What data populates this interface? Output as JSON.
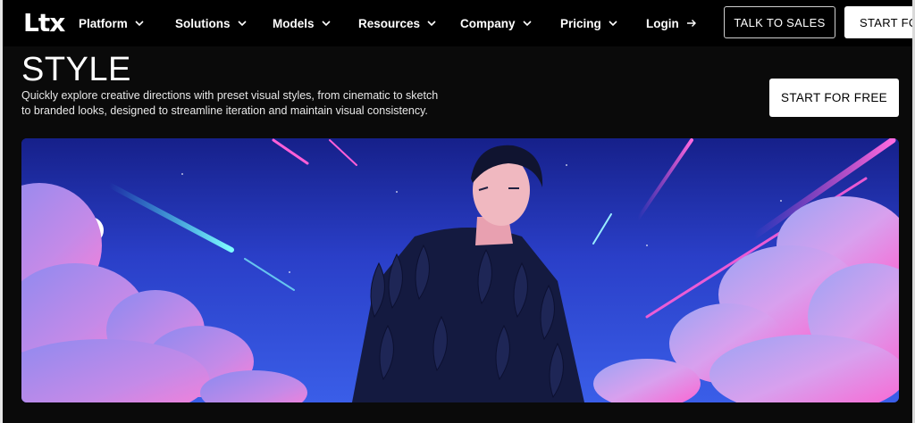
{
  "nav": {
    "logo": "Ltx",
    "items": [
      {
        "label": "Platform",
        "has_dropdown": true
      },
      {
        "label": "Solutions",
        "has_dropdown": true
      },
      {
        "label": "Models",
        "has_dropdown": true
      },
      {
        "label": "Resources",
        "has_dropdown": true
      },
      {
        "label": "Company",
        "has_dropdown": true
      },
      {
        "label": "Pricing",
        "has_dropdown": true
      }
    ],
    "login": "Login",
    "login_icon": "arrow-right-icon",
    "talk_to_sales": "TALK TO SALES",
    "start_for_free": "START FOR FREE"
  },
  "hero": {
    "title": "STYLE",
    "description": "Quickly explore creative directions with preset visual styles, from cinematic to sketch to branded looks, designed to streamline iteration and maintain visual consistency.",
    "cta": "START FOR FREE"
  },
  "colors": {
    "background": "#0a0a0a",
    "nav_background": "#000000",
    "text": "#ffffff",
    "sky_top": "#1a2a9e",
    "sky_accent": "#ff4fd8",
    "comet_cyan": "#3ff0f0"
  }
}
